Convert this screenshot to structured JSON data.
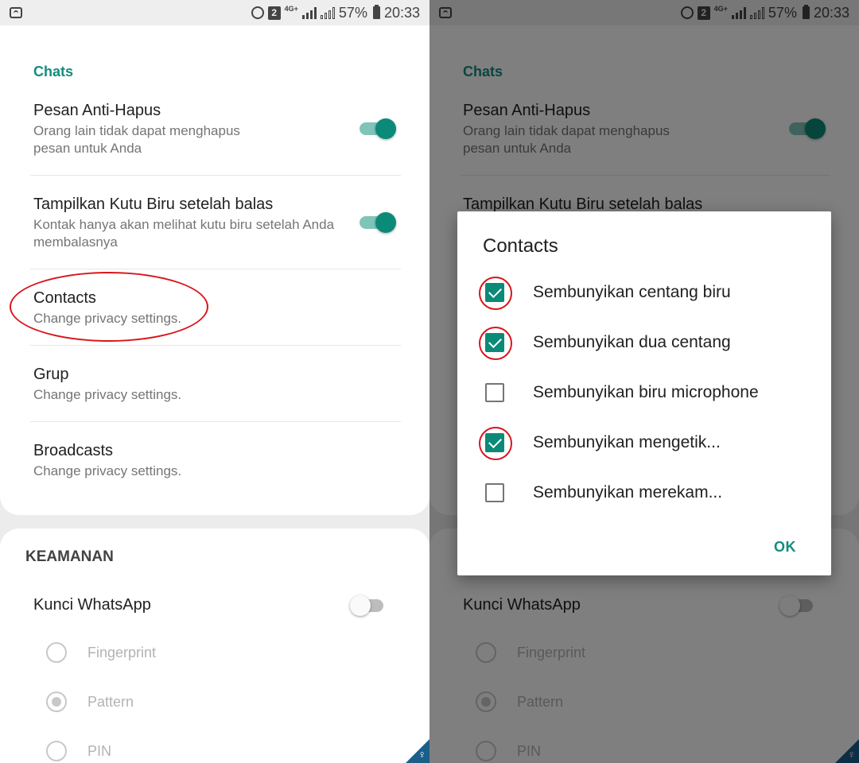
{
  "status_bar": {
    "notification_badge": "2",
    "network": "4G+",
    "battery": "57%",
    "time": "20:33"
  },
  "settings": {
    "section_chats": "Chats",
    "items": [
      {
        "title": "Pesan Anti-Hapus",
        "summary": "Orang lain tidak dapat menghapus pesan untuk Anda",
        "toggle": true
      },
      {
        "title": "Tampilkan Kutu Biru setelah balas",
        "summary": "Kontak hanya akan melihat kutu biru setelah Anda membalasnya",
        "toggle": true
      },
      {
        "title": "Contacts",
        "summary": "Change privacy settings."
      },
      {
        "title": "Grup",
        "summary": "Change privacy settings."
      },
      {
        "title": "Broadcasts",
        "summary": "Change privacy settings."
      }
    ],
    "section_keamanan": "KEAMANAN",
    "lock": {
      "title": "Kunci WhatsApp",
      "toggle": false
    },
    "lock_methods": [
      {
        "label": "Fingerprint",
        "selected": false
      },
      {
        "label": "Pattern",
        "selected": true
      },
      {
        "label": "PIN",
        "selected": false
      }
    ]
  },
  "dialog": {
    "title": "Contacts",
    "options": [
      {
        "label": "Sembunyikan centang biru",
        "checked": true
      },
      {
        "label": "Sembunyikan dua centang",
        "checked": true
      },
      {
        "label": "Sembunyikan biru microphone",
        "checked": false
      },
      {
        "label": "Sembunyikan mengetik...",
        "checked": true
      },
      {
        "label": "Sembunyikan merekam...",
        "checked": false
      }
    ],
    "ok_label": "OK"
  },
  "colors": {
    "accent": "#128c7e",
    "switch_on": "#0b8a78",
    "annotation": "#d8161c"
  },
  "icons": {
    "status_left": "wifi-icon",
    "status_right": [
      "alarm-icon",
      "signal-icon",
      "battery-icon"
    ],
    "corner": "key-icon"
  }
}
